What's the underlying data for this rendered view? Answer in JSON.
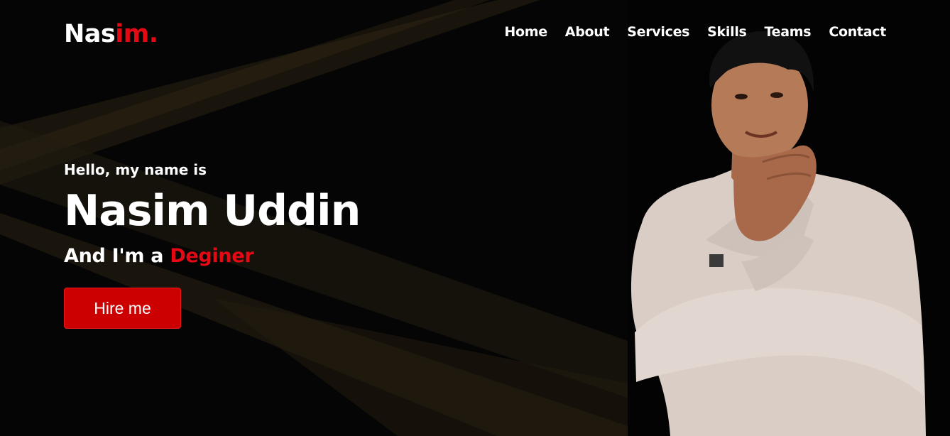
{
  "brand": {
    "logo_part1": "Nas",
    "logo_part2": "im",
    "logo_dot": "."
  },
  "nav": {
    "items": [
      {
        "label": "Home"
      },
      {
        "label": "About"
      },
      {
        "label": "Services"
      },
      {
        "label": "Skills"
      },
      {
        "label": "Teams"
      },
      {
        "label": "Contact"
      }
    ]
  },
  "hero": {
    "greeting": "Hello, my name is",
    "name": "Nasim Uddin",
    "tagline_prefix": "And I'm a ",
    "tagline_role": "Deginer",
    "cta_label": "Hire me"
  },
  "colors": {
    "accent": "#e50914",
    "button": "#cc0000",
    "background": "#050505",
    "text": "#ffffff"
  }
}
